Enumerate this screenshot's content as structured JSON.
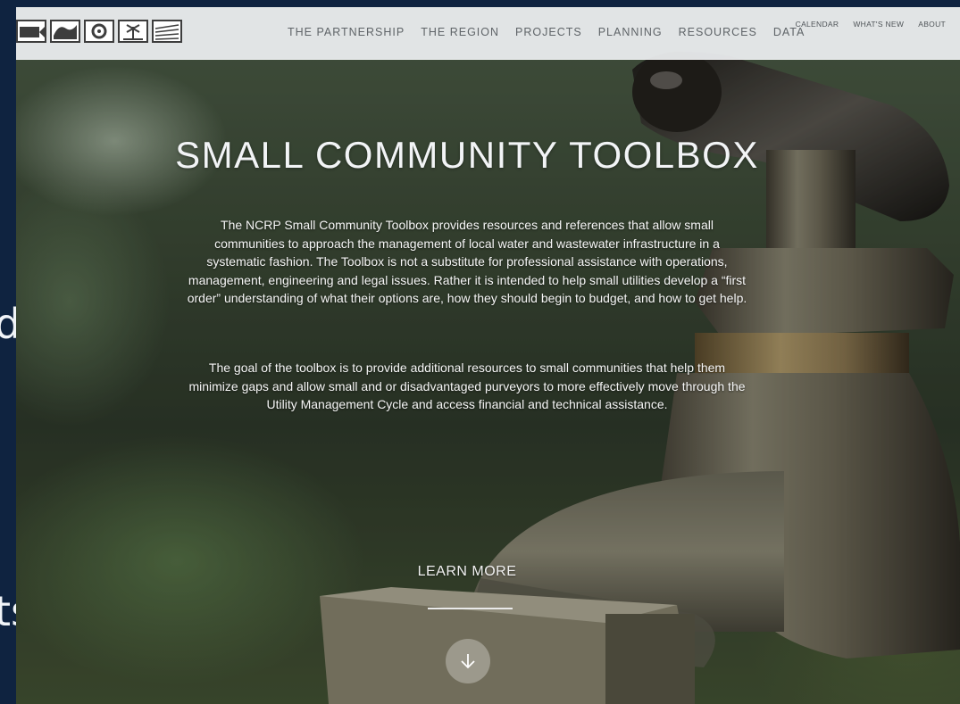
{
  "behind_slide": {
    "line1": "data",
    "line2": "ts"
  },
  "nav": {
    "main": [
      "THE PARTNERSHIP",
      "THE REGION",
      "PROJECTS",
      "PLANNING",
      "RESOURCES",
      "DATA"
    ],
    "utility": [
      "CALENDAR",
      "WHAT'S NEW",
      "ABOUT"
    ]
  },
  "logo": {
    "icons": [
      "fish-icon",
      "wave-icon",
      "gear-icon",
      "windmill-icon",
      "field-icon"
    ]
  },
  "hero": {
    "title": "SMALL COMMUNITY TOOLBOX",
    "paragraph1": "The NCRP Small Community Toolbox provides resources and references that allow small communities to approach the management of local water and wastewater infrastructure in a systematic fashion. The Toolbox is not a substitute for professional assistance with operations, management, engineering and legal issues. Rather it is intended to help small utilities develop a “first order” understanding of what their options are, how they should begin to budget, and how to get help.",
    "paragraph2": "The goal of the toolbox is to provide additional resources to small communities that help them minimize gaps and allow small and or disadvantaged purveyors to more effectively move through the Utility Management Cycle and access financial and technical assistance.",
    "learn_more": "LEARN MORE"
  },
  "icons": {
    "scroll": "arrow-down-icon"
  }
}
